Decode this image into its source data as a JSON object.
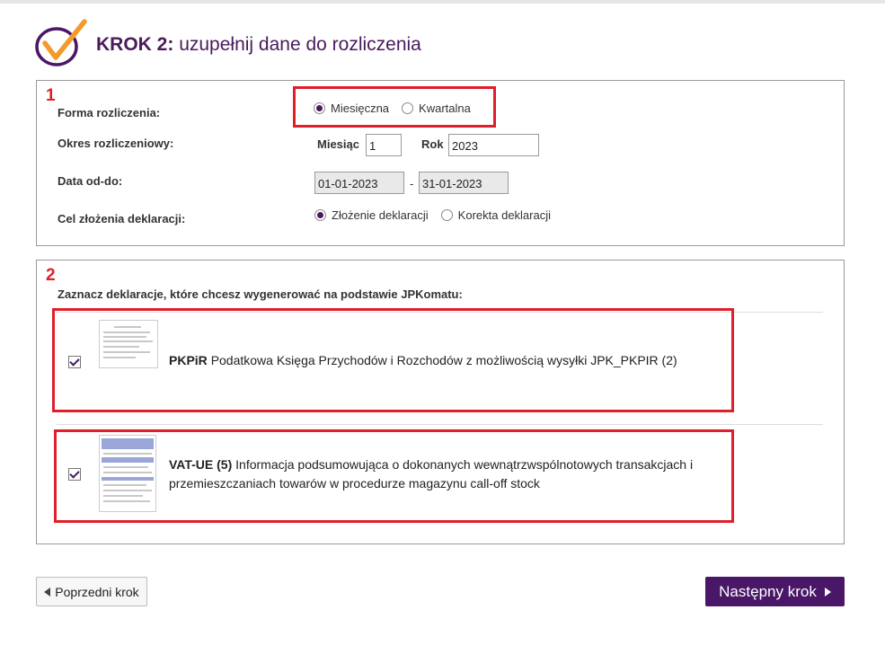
{
  "header": {
    "step_label": "KROK 2:",
    "title": "uzupełnij dane do rozliczenia"
  },
  "section1": {
    "number": "1",
    "forma_label": "Forma rozliczenia:",
    "forma_options": [
      "Miesięczna",
      "Kwartalna"
    ],
    "forma_selected": "Miesięczna",
    "okres_label": "Okres rozliczeniowy:",
    "miesiac_label": "Miesiąc",
    "miesiac_value": "1",
    "rok_label": "Rok",
    "rok_value": "2023",
    "data_label": "Data od-do:",
    "date_from": "01-01-2023",
    "date_sep": "-",
    "date_to": "31-01-2023",
    "cel_label": "Cel złożenia deklaracji:",
    "cel_options": [
      "Złożenie deklaracji",
      "Korekta deklaracji"
    ],
    "cel_selected": "Złożenie deklaracji"
  },
  "section2": {
    "number": "2",
    "instruction": "Zaznacz deklaracje, które chcesz wygenerować na podstawie JPKomatu:",
    "declarations": [
      {
        "code": "PKPiR",
        "description": "Podatkowa Księga Przychodów i Rozchodów z możliwością wysyłki JPK_PKPIR (2)",
        "checked": true
      },
      {
        "code": "VAT-UE (5)",
        "description": "Informacja podsumowująca o dokonanych wewnątrzwspólnotowych transakcjach i przemieszczaniach towarów w procedurze magazynu call-off stock",
        "checked": true
      }
    ]
  },
  "footer": {
    "prev_label": "Poprzedni krok",
    "next_label": "Następny krok"
  },
  "colors": {
    "brand_purple": "#4a1668",
    "accent_orange": "#f39a2c",
    "highlight_red": "#e01f2a"
  }
}
